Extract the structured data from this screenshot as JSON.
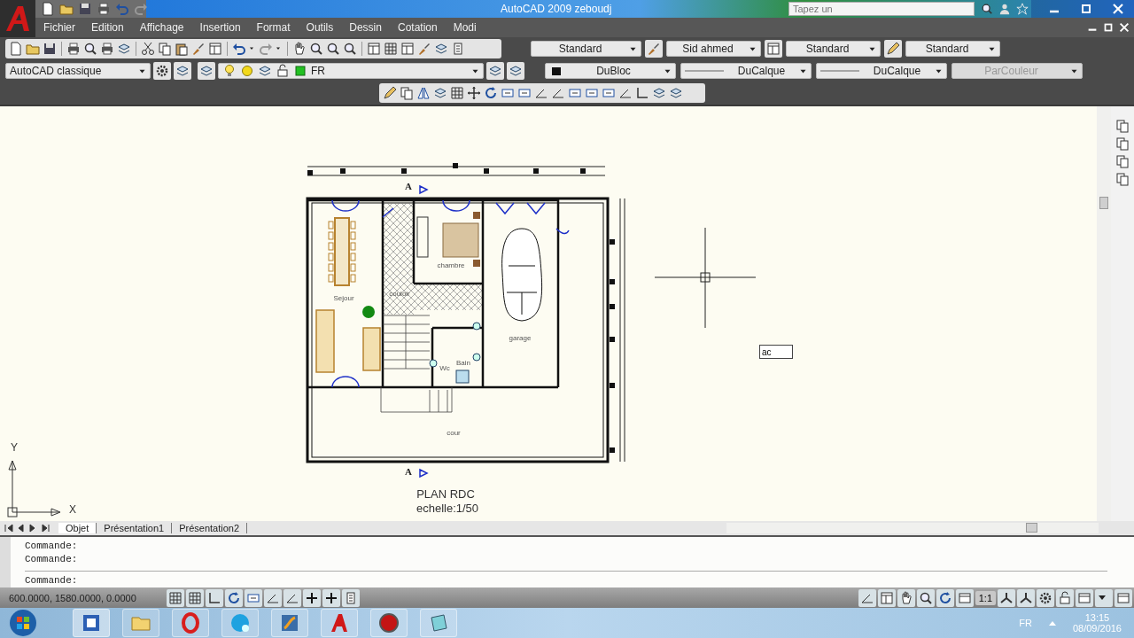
{
  "title_bar": {
    "title": "AutoCAD 2009 zeboudj",
    "search": {
      "placeholder": "Tapez un"
    }
  },
  "menu_bar": [
    "Fichier",
    "Edition",
    "Affichage",
    "Insertion",
    "Format",
    "Outils",
    "Dessin",
    "Cotation",
    "Modi"
  ],
  "styles_toolbar": [
    {
      "kind": "text-style",
      "value": "Standard"
    },
    {
      "kind": "dim-style",
      "value": "Sid ahmed"
    },
    {
      "kind": "table-style",
      "value": "Standard"
    },
    {
      "kind": "multileader-style",
      "value": "Standard"
    }
  ],
  "workspace": {
    "value": "AutoCAD classique"
  },
  "layer": {
    "value": "FR"
  },
  "properties_toolbar": [
    {
      "kind": "color",
      "value": "DuBloc",
      "disabled": false
    },
    {
      "kind": "linetype",
      "value": "DuCalque",
      "disabled": false
    },
    {
      "kind": "lineweight",
      "value": "DuCalque",
      "disabled": false
    },
    {
      "kind": "plot-style",
      "value": "ParCouleur",
      "disabled": true
    }
  ],
  "drawing": {
    "labels": [
      {
        "kind": "room",
        "text": "Sejour"
      },
      {
        "kind": "room",
        "text": "chambre"
      },
      {
        "kind": "room",
        "text": "couloir"
      },
      {
        "kind": "room",
        "text": "garage"
      },
      {
        "kind": "room",
        "text": "Bain"
      },
      {
        "kind": "room",
        "text": "Wc"
      },
      {
        "kind": "room",
        "text": "cour"
      },
      {
        "kind": "section",
        "text": "A"
      },
      {
        "kind": "section",
        "text": "A"
      },
      {
        "kind": "title",
        "text": "PLAN RDC"
      },
      {
        "kind": "title",
        "text": "echelle:1/50"
      }
    ],
    "axes": [
      "Y",
      "X"
    ],
    "dynamic_input": {
      "value": "ac"
    }
  },
  "layout_tabs": [
    {
      "label": "Objet",
      "selected": true
    },
    {
      "label": "Présentation1",
      "selected": false
    },
    {
      "label": "Présentation2",
      "selected": false
    }
  ],
  "command_history": [
    "Commande:",
    "Commande:"
  ],
  "command_prompt": "Commande:",
  "status_bar": {
    "coordinates": "600.0000, 1580.0000, 0.0000",
    "annotation_scale": "1:1"
  },
  "taskbar": {
    "language": "FR",
    "time": "13:15",
    "date": "08/09/2016"
  }
}
